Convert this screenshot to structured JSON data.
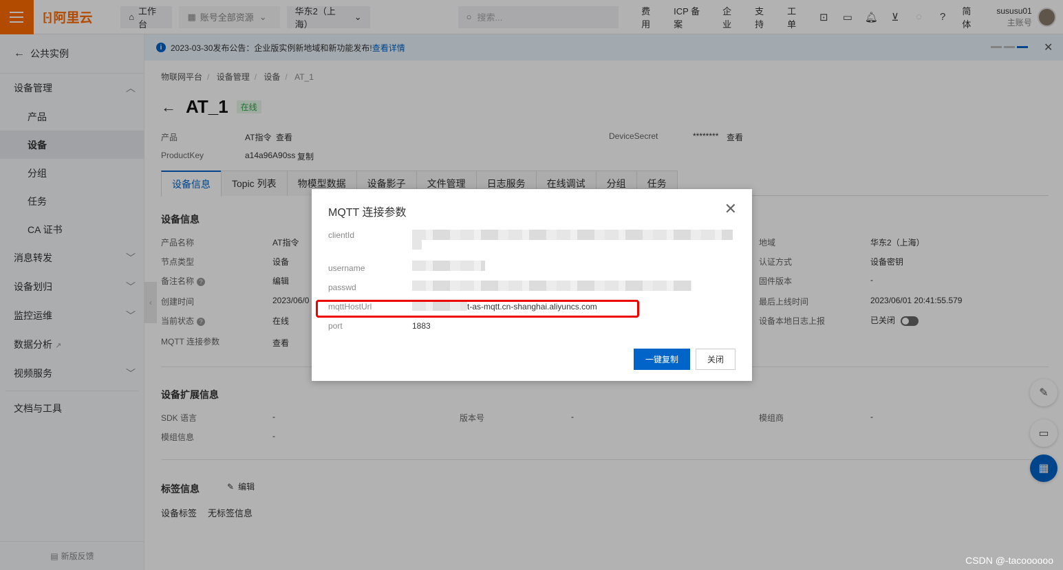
{
  "topbar": {
    "logo": "阿里云",
    "workbench": "工作台",
    "account_resources": "账号全部资源",
    "region": "华东2（上海）",
    "search_placeholder": "搜索...",
    "links": [
      "费用",
      "ICP 备案",
      "企业",
      "支持",
      "工单"
    ],
    "lang": "简体",
    "user_name": "sususu01",
    "user_role": "主账号"
  },
  "sidebar": {
    "back": "公共实例",
    "groups": [
      {
        "label": "设备管理",
        "expanded": true
      },
      {
        "label": "消息转发"
      },
      {
        "label": "设备划归"
      },
      {
        "label": "监控运维"
      },
      {
        "label": "数据分析"
      },
      {
        "label": "视频服务"
      }
    ],
    "subitems": [
      "产品",
      "设备",
      "分组",
      "任务",
      "CA 证书"
    ],
    "docs": "文档与工具",
    "feedback": "新版反馈"
  },
  "notice": {
    "text": "2023-03-30发布公告：企业版实例新地域和新功能发布!",
    "link": "查看详情"
  },
  "breadcrumb": [
    "物联网平台",
    "设备管理",
    "设备",
    "AT_1"
  ],
  "device": {
    "name": "AT_1",
    "status": "在线",
    "product_label": "产品",
    "product_value": "AT指令",
    "view": "查看",
    "productkey_label": "ProductKey",
    "productkey_value": "a14a96A90ss",
    "copy": "复制",
    "secret_label": "DeviceSecret",
    "secret_value": "********"
  },
  "tabs": [
    "设备信息",
    "Topic 列表",
    "物模型数据",
    "设备影子",
    "文件管理",
    "日志服务",
    "在线调试",
    "分组",
    "任务"
  ],
  "info": {
    "title": "设备信息",
    "left_labels": [
      "产品名称",
      "节点类型",
      "备注名称",
      "创建时间",
      "当前状态",
      "MQTT 连接参数"
    ],
    "left_values": [
      "AT指令",
      "设备",
      "编辑",
      "2023/06/0",
      "在线",
      "查看"
    ],
    "right_labels": [
      "地域",
      "认证方式",
      "固件版本",
      "最后上线时间",
      "设备本地日志上报"
    ],
    "right_values": [
      "华东2（上海）",
      "设备密钥",
      "-",
      "2023/06/01 20:41:55.579",
      "已关闭"
    ]
  },
  "ext": {
    "title": "设备扩展信息",
    "sdk_label": "SDK 语言",
    "sdk_value": "-",
    "version_label": "版本号",
    "version_value": "-",
    "module_vendor_label": "模组商",
    "module_vendor_value": "-",
    "module_info_label": "模组信息",
    "module_info_value": "-"
  },
  "tags": {
    "title": "标签信息",
    "edit": "编辑",
    "label": "设备标签",
    "value": "无标签信息"
  },
  "modal": {
    "title": "MQTT 连接参数",
    "clientId_label": "clientId",
    "username_label": "username",
    "passwd_label": "passwd",
    "host_label": "mqttHostUrl",
    "host_value": "t-as-mqtt.cn-shanghai.aliyuncs.com",
    "port_label": "port",
    "port_value": "1883",
    "copy_btn": "一键复制",
    "close_btn": "关闭"
  },
  "watermark": "CSDN @-tacoooooo"
}
